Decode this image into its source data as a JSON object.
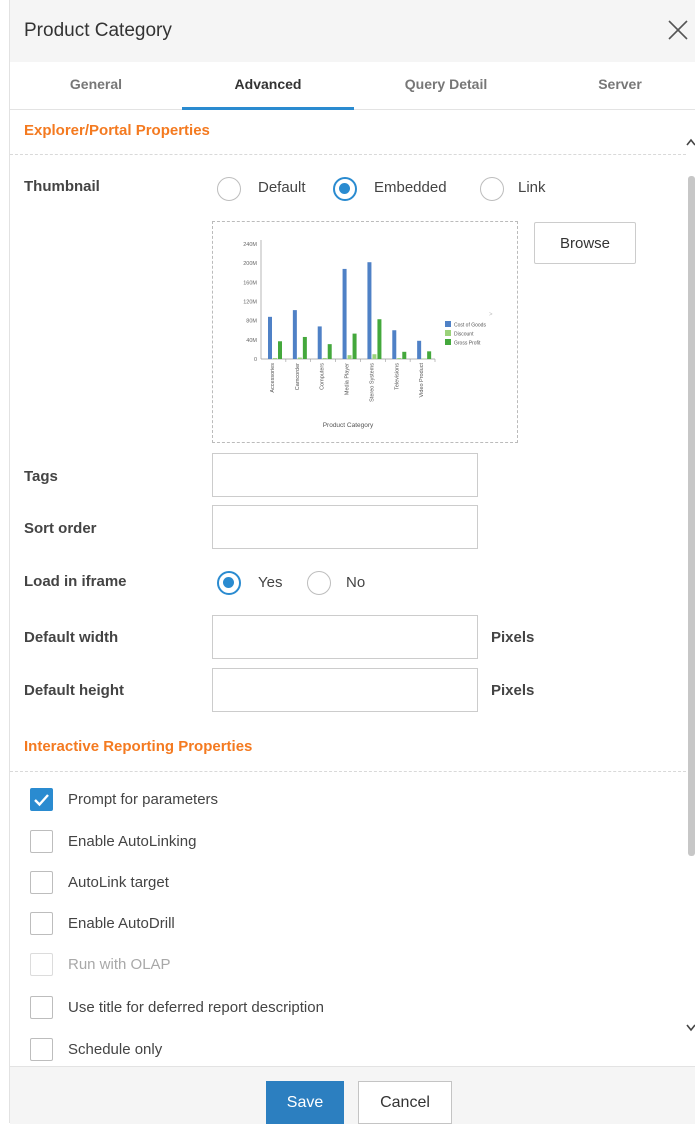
{
  "dialog": {
    "title": "Product Category",
    "close_icon": "close-icon"
  },
  "tabs": [
    {
      "label": "General",
      "active": false
    },
    {
      "label": "Advanced",
      "active": true
    },
    {
      "label": "Query Detail",
      "active": false
    },
    {
      "label": "Server",
      "active": false
    }
  ],
  "explorer": {
    "section_title": "Explorer/Portal Properties",
    "thumbnail": {
      "label": "Thumbnail",
      "options": [
        "Default",
        "Embedded",
        "Link"
      ],
      "selected": "Embedded",
      "browse_label": "Browse"
    },
    "tags": {
      "label": "Tags",
      "value": ""
    },
    "sort_order": {
      "label": "Sort order",
      "value": ""
    },
    "load_in_iframe": {
      "label": "Load in iframe",
      "options": [
        "Yes",
        "No"
      ],
      "selected": "Yes"
    },
    "default_width": {
      "label": "Default width",
      "value": "",
      "unit": "Pixels"
    },
    "default_height": {
      "label": "Default height",
      "value": "",
      "unit": "Pixels"
    }
  },
  "interactive": {
    "section_title": "Interactive Reporting Properties",
    "options": [
      {
        "label": "Prompt for parameters",
        "checked": true,
        "disabled": false
      },
      {
        "label": "Enable AutoLinking",
        "checked": false,
        "disabled": false
      },
      {
        "label": "AutoLink target",
        "checked": false,
        "disabled": false
      },
      {
        "label": "Enable AutoDrill",
        "checked": false,
        "disabled": false
      },
      {
        "label": "Run with OLAP",
        "checked": false,
        "disabled": true
      },
      {
        "label": "Use title for deferred report description",
        "checked": false,
        "disabled": false
      },
      {
        "label": "Schedule only",
        "checked": false,
        "disabled": false
      }
    ]
  },
  "footer": {
    "save_label": "Save",
    "cancel_label": "Cancel"
  },
  "colors": {
    "accent": "#2a8bd0",
    "section_title": "#f47a20",
    "save_button": "#2c7fc0"
  },
  "chart_data": {
    "type": "bar",
    "title": "",
    "xlabel": "Product Category",
    "ylabel": "",
    "ylim": [
      0,
      240
    ],
    "yticks": [
      "0",
      "40M",
      "80M",
      "120M",
      "160M",
      "200M",
      "240M"
    ],
    "categories": [
      "Accessories",
      "Camcorder",
      "Computers",
      "Media Player",
      "Stereo Systems",
      "Televisions",
      "Video Product"
    ],
    "series": [
      {
        "name": "Cost of Goods",
        "color": "#4f81c6",
        "values": [
          88,
          102,
          68,
          188,
          202,
          60,
          38
        ]
      },
      {
        "name": "Discount",
        "color": "#9bd27a",
        "values": [
          2,
          3,
          2,
          8,
          10,
          2,
          1
        ]
      },
      {
        "name": "Gross Profit",
        "color": "#44a83c",
        "values": [
          37,
          46,
          31,
          53,
          83,
          15,
          16
        ]
      }
    ],
    "legend": "right"
  }
}
